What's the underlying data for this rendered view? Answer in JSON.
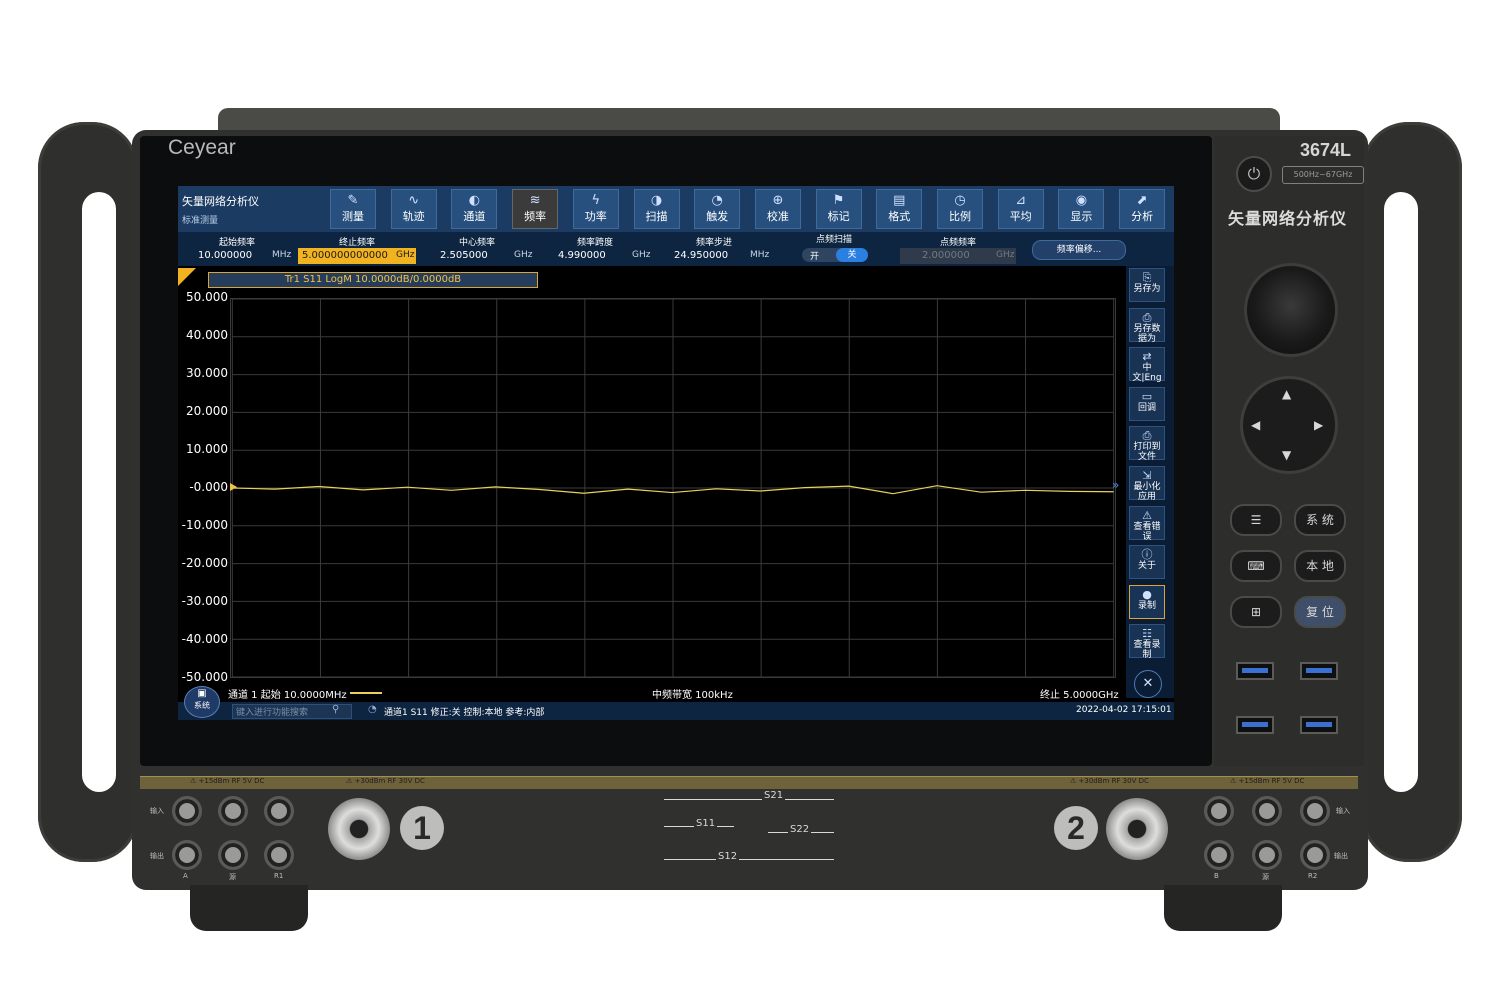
{
  "instrument": {
    "brand": "Ceyear",
    "model": "3674L",
    "freq_range": "500Hz~67GHz",
    "side_title": "矢量网络分析仪"
  },
  "front_panel": {
    "buttons": [
      {
        "id": "menu",
        "label": "",
        "icon": "menu-lines-icon"
      },
      {
        "id": "system",
        "label": "系 统"
      },
      {
        "id": "keyboard",
        "label": "",
        "icon": "keyboard-icon"
      },
      {
        "id": "local",
        "label": "本 地"
      },
      {
        "id": "windows",
        "label": "",
        "icon": "windows-logo-icon"
      },
      {
        "id": "reset",
        "label": "复 位"
      }
    ],
    "power_icon": "power-icon",
    "warnings": [
      "⚠ +15dBm RF 5V DC",
      "⚠ +30dBm RF 30V DC",
      "⚠ +30dBm RF 30V DC",
      "⚠ +15dBm RF 5V DC"
    ],
    "left_labels": {
      "in": "输入",
      "out": "输出",
      "a": "A",
      "src": "源",
      "r1": "R1"
    },
    "right_labels": {
      "in": "输入",
      "out": "输出",
      "b": "B",
      "src": "源",
      "r2": "R2"
    },
    "port1": "1",
    "port2": "2",
    "sparams": {
      "s21": "S21",
      "s11": "S11",
      "s22": "S22",
      "s12": "S12"
    }
  },
  "app": {
    "title": "矢量网络分析仪",
    "subtitle": "标准测量",
    "toolbar": [
      {
        "label": "测量",
        "icon": "ruler-icon"
      },
      {
        "label": "轨迹",
        "icon": "trace-icon"
      },
      {
        "label": "通道",
        "icon": "channel-icon"
      },
      {
        "label": "频率",
        "icon": "frequency-icon",
        "active": true
      },
      {
        "label": "功率",
        "icon": "power-level-icon"
      },
      {
        "label": "扫描",
        "icon": "sweep-icon"
      },
      {
        "label": "触发",
        "icon": "trigger-icon"
      },
      {
        "label": "校准",
        "icon": "calibration-icon"
      },
      {
        "label": "标记",
        "icon": "marker-icon"
      },
      {
        "label": "格式",
        "icon": "format-icon"
      },
      {
        "label": "比例",
        "icon": "scale-icon"
      },
      {
        "label": "平均",
        "icon": "average-icon"
      },
      {
        "label": "显示",
        "icon": "display-icon"
      },
      {
        "label": "分析",
        "icon": "analysis-icon"
      }
    ],
    "freq": {
      "start": {
        "label": "起始频率",
        "value": "10.000000",
        "unit": "MHz"
      },
      "stop": {
        "label": "终止频率",
        "value": "5.000000000000",
        "unit": "GHz"
      },
      "center": {
        "label": "中心频率",
        "value": "2.505000",
        "unit": "GHz"
      },
      "span": {
        "label": "频率跨度",
        "value": "4.990000",
        "unit": "GHz"
      },
      "step": {
        "label": "频率步进",
        "value": "24.950000",
        "unit": "MHz"
      },
      "cw_sweep": {
        "label": "点频扫描",
        "on": "开",
        "off": "关"
      },
      "cw_freq": {
        "label": "点频频率",
        "value": "2.000000",
        "unit": "GHz"
      },
      "offset_button": "频率偏移..."
    },
    "trace_label": "Tr1 S11 LogM 10.0000dB/0.0000dB",
    "y_ticks": [
      "50.000",
      "40.000",
      "30.000",
      "20.000",
      "10.000",
      "-0.000",
      "-10.000",
      "-20.000",
      "-30.000",
      "-40.000",
      "-50.000"
    ],
    "right_buttons": [
      {
        "label": "另存为",
        "icon": "save-as-icon"
      },
      {
        "label": "另存数据为",
        "icon": "save-data-icon"
      },
      {
        "label": "中文|Eng",
        "icon": "language-icon"
      },
      {
        "label": "回调",
        "icon": "recall-icon"
      },
      {
        "label": "打印到文件",
        "icon": "print-icon"
      },
      {
        "label": "最小化应用",
        "icon": "minimize-icon"
      },
      {
        "label": "查看错误",
        "icon": "error-icon"
      },
      {
        "label": "关于",
        "icon": "info-icon"
      },
      {
        "label": "录制",
        "icon": "record-icon"
      },
      {
        "label": "查看录制",
        "icon": "view-record-icon"
      }
    ],
    "status": {
      "channel_start": "通道 1 起始 10.0000MHz",
      "ifbw": "中频带宽 100kHz",
      "stop": "终止 5.0000GHz",
      "system_button": "系统",
      "search_placeholder": "键入进行功能搜索",
      "info": "通道1 S11 修正:关 控制:本地 参考:内部",
      "datetime": "2022-04-02 17:15:01"
    }
  },
  "chart_data": {
    "type": "line",
    "title": "",
    "xlabel": "",
    "ylabel": "",
    "xlim": [
      0.01,
      5.0
    ],
    "ylim": [
      -50,
      50
    ],
    "grid": true,
    "series": [
      {
        "name": "Tr1 S11",
        "color": "#e8d25a",
        "x": [
          0.01,
          0.25,
          0.5,
          0.75,
          1.0,
          1.25,
          1.5,
          1.75,
          2.0,
          2.25,
          2.5,
          2.75,
          3.0,
          3.25,
          3.5,
          3.75,
          4.0,
          4.25,
          4.5,
          4.75,
          5.0
        ],
        "y": [
          0.0,
          -0.3,
          0.4,
          -0.5,
          0.2,
          -0.6,
          0.3,
          -0.4,
          -1.4,
          -0.3,
          -1.2,
          -0.2,
          -0.8,
          0.1,
          0.5,
          -1.5,
          0.6,
          -1.1,
          -0.6,
          -0.9,
          -1.0
        ]
      }
    ]
  }
}
